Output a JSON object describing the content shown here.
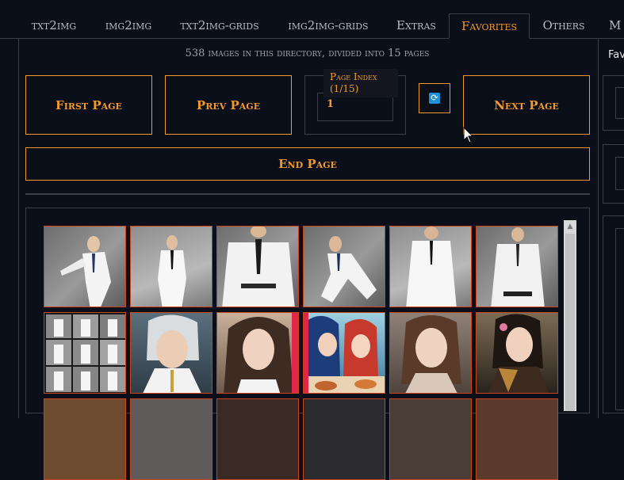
{
  "tabs": [
    {
      "label": "txt2img"
    },
    {
      "label": "img2img"
    },
    {
      "label": "txt2img-grids"
    },
    {
      "label": "img2img-grids"
    },
    {
      "label": "Extras"
    },
    {
      "label": "Favorites"
    },
    {
      "label": "Others"
    },
    {
      "label": "M"
    }
  ],
  "active_tab": "Favorites",
  "directory_info": "538 images in this directory, divided into 15 pages",
  "buttons": {
    "first": "First Page",
    "prev": "Prev Page",
    "next": "Next Page",
    "end": "End Page"
  },
  "page_index": {
    "label": "Page Index (1/15)",
    "value": "1"
  },
  "refresh_icon": "refresh-icon",
  "right_panel": {
    "label": "Fav"
  },
  "colors": {
    "accent": "#f39a2d",
    "thumb_border": "#c8451b",
    "background": "#0b0f19"
  }
}
